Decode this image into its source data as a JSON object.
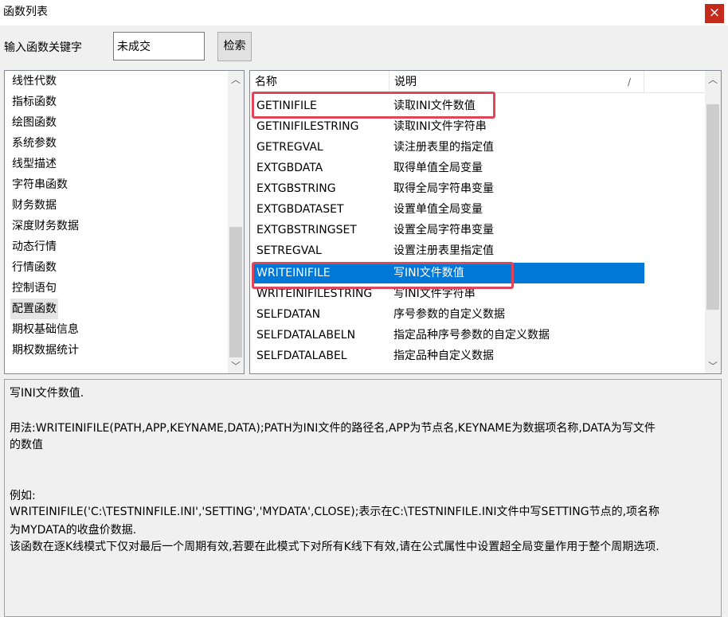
{
  "window": {
    "title": "函数列表",
    "close_glyph": "×"
  },
  "search": {
    "label": "输入函数关键字",
    "value": "未成交",
    "button": "检索"
  },
  "categories": [
    "线性代数",
    "指标函数",
    "绘图函数",
    "系统参数",
    "线型描述",
    "字符串函数",
    "财务数据",
    "深度财务数据",
    "动态行情",
    "行情函数",
    "控制语句",
    "配置函数",
    "期权基础信息",
    "期权数据统计"
  ],
  "categories_selected_index": 11,
  "function_table": {
    "columns": [
      "名称",
      "说明"
    ],
    "sort_glyph": "/",
    "rows": [
      [
        "GETINIFILE",
        "读取INI文件数值"
      ],
      [
        "GETINIFILESTRING",
        "读取INI文件字符串"
      ],
      [
        "GETREGVAL",
        "读注册表里的指定值"
      ],
      [
        "EXTGBDATA",
        "取得单值全局变量"
      ],
      [
        "EXTGBSTRING",
        "取得全局字符串变量"
      ],
      [
        "EXTGBDATASET",
        "设置单值全局变量"
      ],
      [
        "EXTGBSTRINGSET",
        "设置全局字符串变量"
      ],
      [
        "SETREGVAL",
        "设置注册表里指定值"
      ],
      [
        "WRITEINIFILE",
        "写INI文件数值"
      ],
      [
        "WRITEINIFILESTRING",
        "写INI文件字符串"
      ],
      [
        "SELFDATAN",
        "序号参数的自定义数据"
      ],
      [
        "SELFDATALABELN",
        "指定品种序号参数的自定义数据"
      ],
      [
        "SELFDATALABEL",
        "指定品种自定义数据"
      ]
    ],
    "selected_index": 8
  },
  "description": {
    "line1": "写INI文件数值.",
    "line2": "用法:WRITEINIFILE(PATH,APP,KEYNAME,DATA);PATH为INI文件的路径名,APP为节点名,KEYNAME为数据项名称,DATA为写文件",
    "line3": "的数值",
    "line4": "例如:",
    "line5": "WRITEINIFILE('C:\\TESTNINFILE.INI','SETTING','MYDATA',CLOSE);表示在C:\\TESTNINFILE.INI文件中写SETTING节点的,项名称",
    "line6": "为MYDATA的收盘价数据.",
    "line7": "该函数在逐K线模式下仅对最后一个周期有效,若要在此模式下对所有K线下有效,请在公式属性中设置超全局变量作用于整个周期选项."
  },
  "icons": {
    "scroll_up": "chevron-up-icon",
    "scroll_down": "chevron-down-icon",
    "close": "close-icon"
  },
  "colors": {
    "selection": "#0078d7",
    "highlight_box": "#e0465a",
    "close_button": "#c42b1c"
  }
}
